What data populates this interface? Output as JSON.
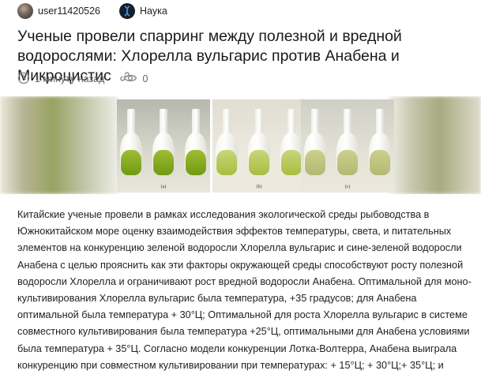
{
  "author": {
    "name": "user11420526",
    "avatar": "user-avatar"
  },
  "community": {
    "name": "Наука",
    "icon": "science-community-icon"
  },
  "post": {
    "title": "Ученые провели спарринг между полезной и вредной водорослями: Хлорелла вульгарис против Анабена и Микроцистис",
    "link_icon": "link-icon",
    "time": "1 минуту назад",
    "views": "0",
    "image": {
      "panels": [
        {
          "caption": "(a)"
        },
        {
          "caption": "(b)"
        },
        {
          "caption": "(c)"
        }
      ]
    },
    "body": "Китайские ученые провели в рамках исследования экологической среды рыбоводства в Южнокитайском море оценку взаимодействия эффектов температуры, света, и питательных элементов на конкуренцию зеленой водоросли Хлорелла вульгарис и сине-зеленой водоросли Анабена с целью прояснить как эти факторы окружающей среды способствуют росту полезной водоросли Хлорелла и ограничивают рост вредной водоросли Анабена. Оптимальной для моно-культивирования Хлорелла вульгарис была температура, +35 градусов; для Анабена оптимальной была температура + 30°Ц; Оптимальной для роста Хлорелла вульгарис в системе совместного культивирования была температура +25°Ц, оптимальными для Анабена условиями была температура + 35°Ц. Согласно модели конкуренции Лотка-Волтерра, Анабена выиграла конкуренцию при совместном культивировании при температурах: + 15°Ц; + 30°Ц;+ 35°Ц; и"
  },
  "colors": {
    "text": "#1a1a1a",
    "muted": "#666666",
    "community_badge": "#14202e"
  }
}
